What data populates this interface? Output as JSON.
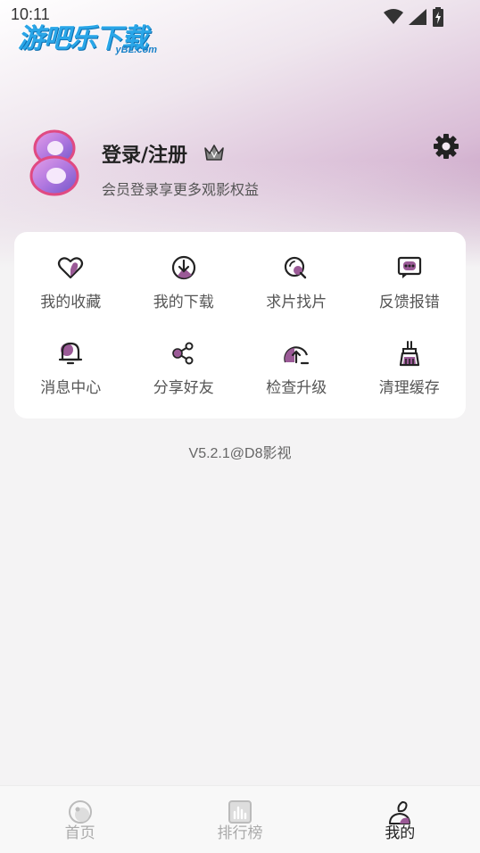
{
  "status_bar": {
    "time": "10:11"
  },
  "watermark": {
    "title": "游吧乐下载",
    "subtitle": "yBL.com"
  },
  "profile": {
    "login_title": "登录/注册",
    "login_subtitle": "会员登录享更多观影权益"
  },
  "grid": {
    "items": [
      {
        "label": "我的收藏",
        "icon": "heart-icon"
      },
      {
        "label": "我的下载",
        "icon": "download-icon"
      },
      {
        "label": "求片找片",
        "icon": "search-icon"
      },
      {
        "label": "反馈报错",
        "icon": "feedback-icon"
      },
      {
        "label": "消息中心",
        "icon": "bell-icon"
      },
      {
        "label": "分享好友",
        "icon": "share-icon"
      },
      {
        "label": "检查升级",
        "icon": "upgrade-icon"
      },
      {
        "label": "清理缓存",
        "icon": "broom-icon"
      }
    ]
  },
  "version": "V5.2.1@D8影视",
  "bottom_nav": {
    "items": [
      {
        "label": "首页",
        "icon": "home-icon",
        "active": false
      },
      {
        "label": "排行榜",
        "icon": "ranking-icon",
        "active": false
      },
      {
        "label": "我的",
        "icon": "profile-icon",
        "active": true
      }
    ]
  },
  "colors": {
    "accent": "#9b5a97",
    "card": "#ffffff",
    "background": "#f4f3f4"
  }
}
